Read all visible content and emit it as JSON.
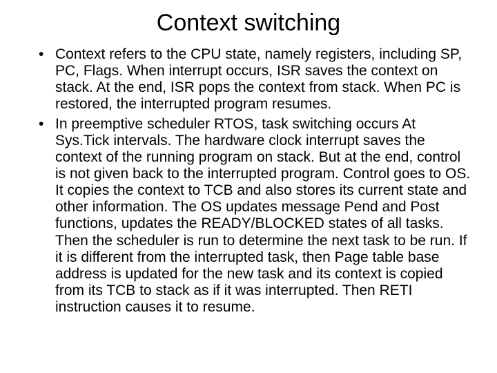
{
  "slide": {
    "title": "Context switching",
    "bullets": [
      "Context refers to the CPU state, namely registers, including SP, PC, Flags. When interrupt occurs, ISR saves the context on stack. At the end, ISR pops the context from stack. When PC is restored, the interrupted program resumes.",
      "In preemptive scheduler RTOS, task switching occurs At Sys.Tick intervals. The hardware clock interrupt saves the context of the running program on stack. But at the end, control is not given back to the interrupted program. Control goes to OS. It copies the context to TCB and also stores its current state and other information. The OS updates message Pend and Post functions, updates the READY/BLOCKED states of all tasks. Then the scheduler is run to determine the next task to be run. If it is different from the interrupted task, then Page table base address is updated for the new task and its context is copied from its TCB to stack as if it was interrupted. Then RETI instruction causes it to resume."
    ]
  }
}
